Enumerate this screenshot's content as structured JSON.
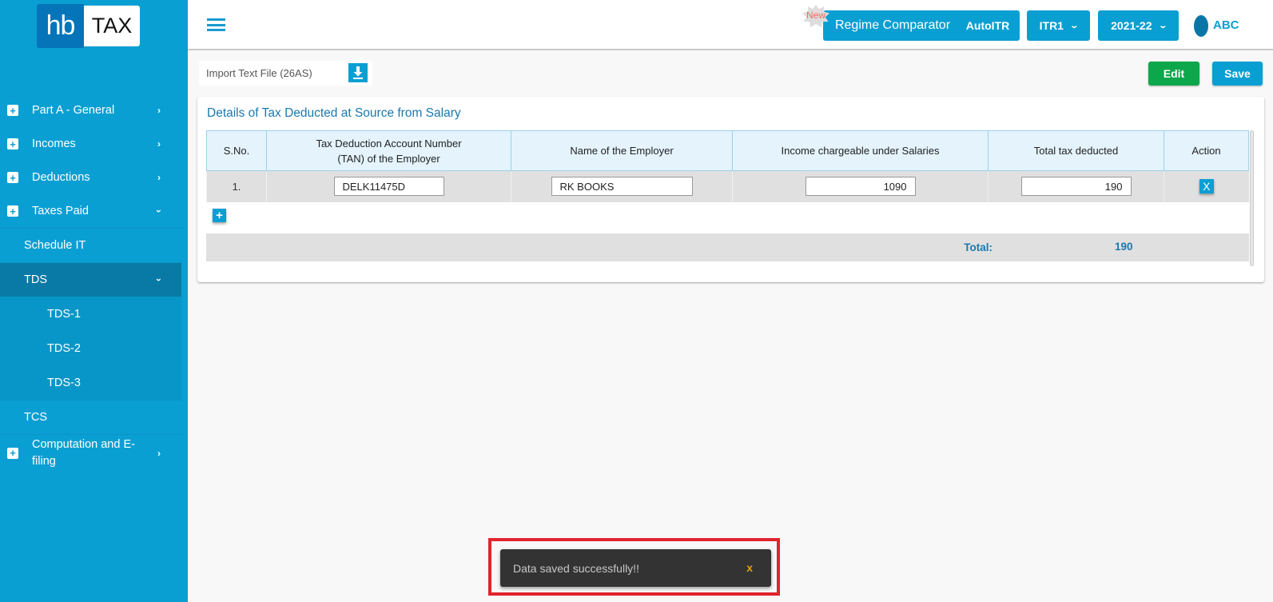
{
  "app": {
    "logo_left": "hb",
    "logo_right": "TAX"
  },
  "sidebar": {
    "items": [
      {
        "label": "Part A - General",
        "expanded": false
      },
      {
        "label": "Incomes",
        "expanded": false
      },
      {
        "label": "Deductions",
        "expanded": false
      },
      {
        "label": "Taxes Paid",
        "expanded": true
      }
    ],
    "taxes_paid_children": [
      {
        "label": "Schedule IT"
      },
      {
        "label": "TDS",
        "active": true,
        "children": [
          "TDS-1",
          "TDS-2",
          "TDS-3"
        ]
      },
      {
        "label": "TCS"
      }
    ],
    "computation": {
      "label": "Computation and E-filing"
    }
  },
  "header": {
    "new_badge": "New",
    "regime_comparator": "Regime Comparator",
    "autoitr": "AutoITR",
    "itr_select": "ITR1",
    "year_select": "2021-22",
    "user": "ABC"
  },
  "toolbar": {
    "import_label": "Import Text File (26AS)",
    "edit_label": "Edit",
    "save_label": "Save"
  },
  "section": {
    "title": "Details of Tax Deducted at Source from Salary",
    "columns": [
      "S.No.",
      "Tax Deduction Account Number (TAN) of the Employer",
      "Name of the Employer",
      "Income chargeable under Salaries",
      "Total tax deducted",
      "Action"
    ],
    "column_tan_line1": "Tax Deduction Account Number",
    "column_tan_line2": "(TAN) of the Employer",
    "rows": [
      {
        "sno": "1.",
        "tan": "DELK11475D",
        "employer": "RK BOOKS",
        "income": "1090",
        "tax": "190",
        "action": "X"
      }
    ],
    "add_label": "+",
    "total_label": "Total:",
    "total_value": "190"
  },
  "toast": {
    "message": "Data saved successfully!!",
    "close": "x"
  },
  "colors": {
    "primary": "#0a9fd3",
    "edit": "#0ca74a",
    "title": "#1c78ad",
    "highlight_frame": "#e0242d"
  }
}
